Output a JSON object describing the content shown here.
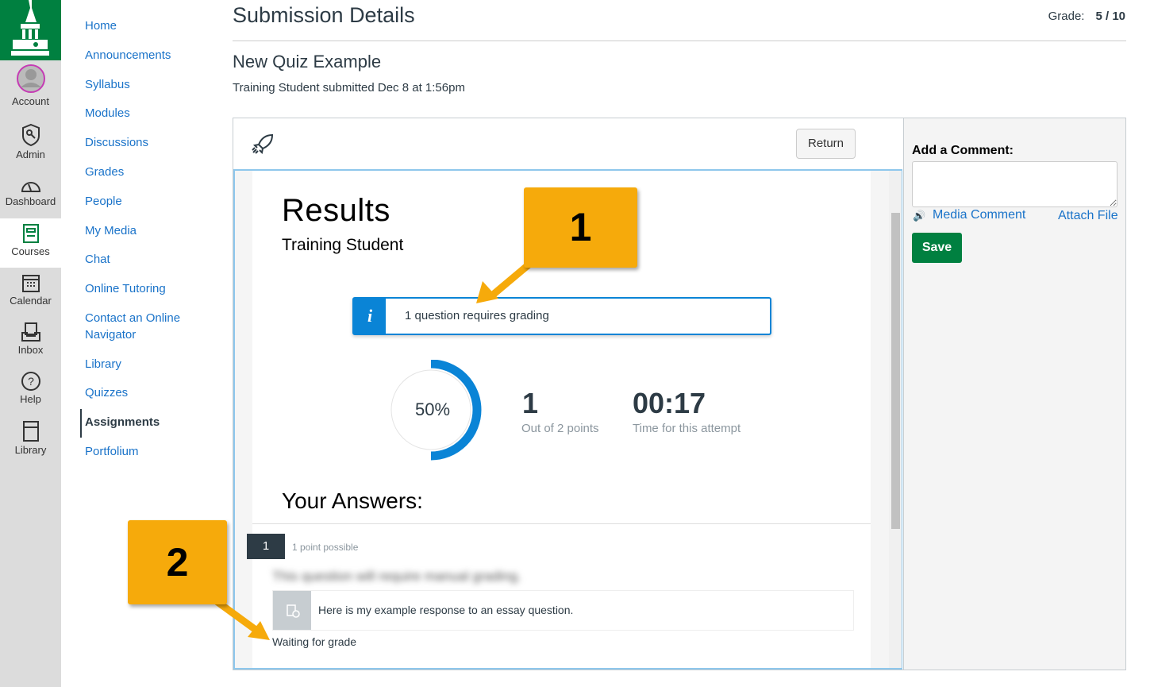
{
  "global_nav": [
    {
      "label": "Account",
      "icon": "avatar-icon"
    },
    {
      "label": "Admin",
      "icon": "shield-key-icon"
    },
    {
      "label": "Dashboard",
      "icon": "speedometer-icon"
    },
    {
      "label": "Courses",
      "icon": "book-icon"
    },
    {
      "label": "Calendar",
      "icon": "calendar-icon"
    },
    {
      "label": "Inbox",
      "icon": "inbox-icon"
    },
    {
      "label": "Help",
      "icon": "help-icon"
    },
    {
      "label": "Library",
      "icon": "library-icon"
    }
  ],
  "course_nav": [
    "Home",
    "Announcements",
    "Syllabus",
    "Modules",
    "Discussions",
    "Grades",
    "People",
    "My Media",
    "Chat",
    "Online Tutoring",
    "Contact an Online Navigator",
    "Library",
    "Quizzes",
    "Assignments",
    "Portfolium"
  ],
  "header": {
    "title": "Submission Details",
    "grade_label": "Grade:",
    "grade_value": "5 / 10"
  },
  "quiz": {
    "name": "New Quiz Example",
    "submitted": "Training Student submitted Dec 8 at 1:56pm"
  },
  "toolbar": {
    "return": "Return"
  },
  "results": {
    "title": "Results",
    "student": "Training Student",
    "info": "1 question requires grading",
    "percent": "50%",
    "percent_value": 50,
    "points": "1",
    "points_label": "Out of 2 points",
    "time": "00:17",
    "time_label": "Time for this attempt",
    "answers_title": "Your Answers:"
  },
  "question": {
    "number": "1",
    "points": "1 point possible",
    "text_blurred": "This question will require manual grading.",
    "response": "Here is my example response to an essay question.",
    "status": "Waiting for grade"
  },
  "comment": {
    "label": "Add a Comment:",
    "media": "Media Comment",
    "attach": "Attach File",
    "save": "Save"
  },
  "callouts": [
    "1",
    "2"
  ],
  "colors": {
    "brand": "#008040",
    "link": "#1a73c9",
    "info": "#0a84d6",
    "callout": "#f6aa0b"
  }
}
